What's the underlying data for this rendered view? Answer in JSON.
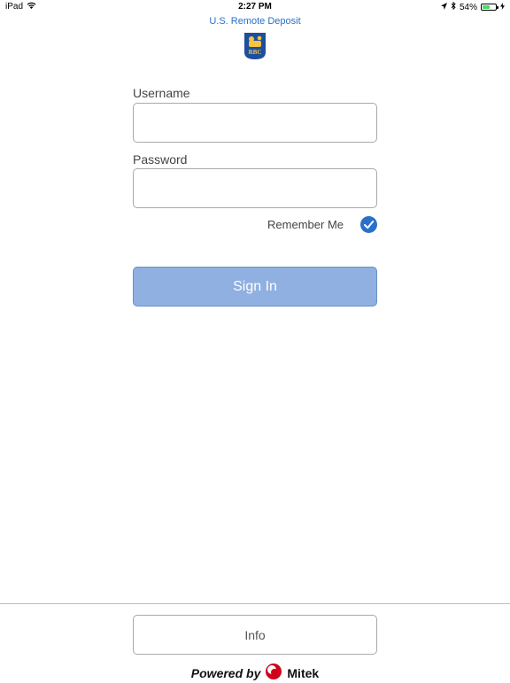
{
  "status_bar": {
    "device": "iPad",
    "time": "2:27 PM",
    "battery_percent_label": "54%",
    "battery_level": 0.54,
    "icons": [
      "wifi-icon",
      "location-arrow-icon",
      "bluetooth-icon",
      "battery-icon",
      "charging-bolt-icon"
    ]
  },
  "header": {
    "title": "U.S. Remote Deposit",
    "logo_text": "RBC"
  },
  "form": {
    "username_label": "Username",
    "username_value": "",
    "password_label": "Password",
    "password_value": "",
    "remember_label": "Remember Me",
    "remember_checked": true,
    "signin_label": "Sign In"
  },
  "footer": {
    "info_label": "Info",
    "powered_by": "Powered by",
    "brand": "Mitek"
  },
  "colors": {
    "accent_blue": "#2a6fc9",
    "signin_bg": "#8fb0e0",
    "rbc_blue": "#1c4f9c",
    "rbc_gold": "#f6c342",
    "battery_green": "#4cd964",
    "mitek_red": "#d0021b"
  }
}
